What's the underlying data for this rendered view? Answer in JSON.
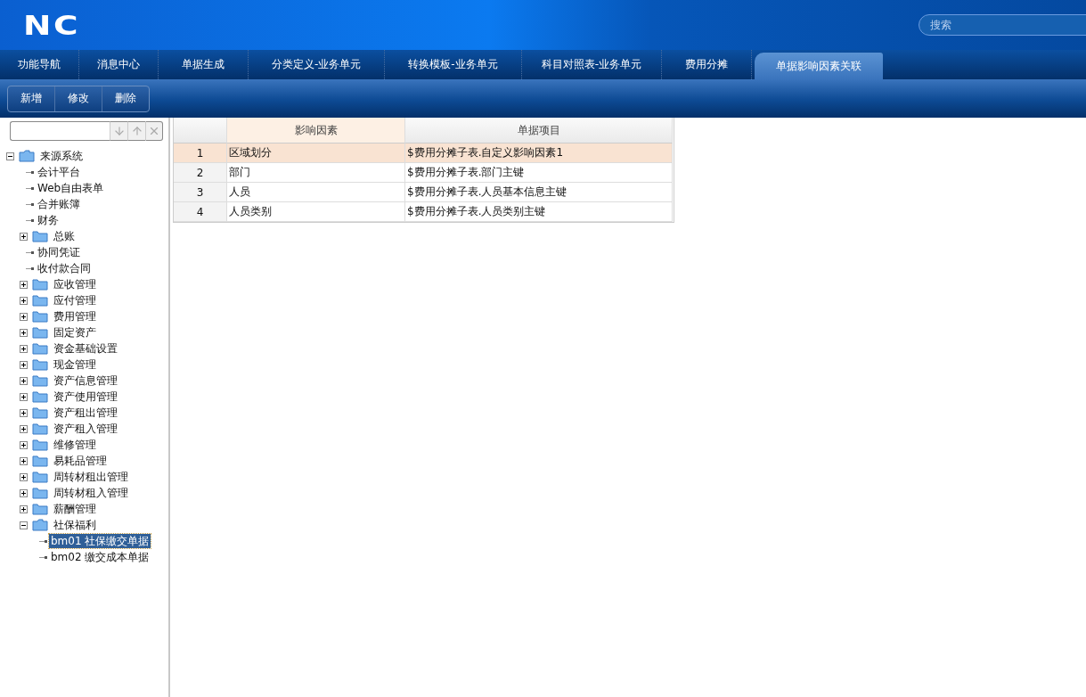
{
  "header": {
    "logo": "NC",
    "search": {
      "placeholder": "搜索"
    }
  },
  "tabs": [
    {
      "label": "功能导航",
      "selected": false
    },
    {
      "label": "消息中心",
      "selected": false
    },
    {
      "label": "单据生成",
      "selected": false
    },
    {
      "label": "分类定义-业务单元",
      "selected": false
    },
    {
      "label": "转换模板-业务单元",
      "selected": false
    },
    {
      "label": "科目对照表-业务单元",
      "selected": false
    },
    {
      "label": "费用分摊",
      "selected": false
    },
    {
      "label": "单据影响因素关联",
      "selected": true
    }
  ],
  "toolbar": {
    "buttons": [
      "新增",
      "修改",
      "删除"
    ]
  },
  "tree": {
    "items": [
      {
        "label": "来源系统",
        "kind": "folder",
        "expanded": true,
        "selected": false,
        "children": [
          {
            "label": "会计平台",
            "kind": "leaf",
            "selected": false
          },
          {
            "label": "Web自由表单",
            "kind": "leaf",
            "selected": false
          },
          {
            "label": "合并账簿",
            "kind": "leaf",
            "selected": false
          },
          {
            "label": "财务",
            "kind": "leaf",
            "selected": false
          },
          {
            "label": "总账",
            "kind": "folder",
            "expanded": false,
            "selected": false
          },
          {
            "label": "协同凭证",
            "kind": "leaf",
            "selected": false
          },
          {
            "label": "收付款合同",
            "kind": "leaf",
            "selected": false
          },
          {
            "label": "应收管理",
            "kind": "folder",
            "expanded": false,
            "selected": false
          },
          {
            "label": "应付管理",
            "kind": "folder",
            "expanded": false,
            "selected": false
          },
          {
            "label": "费用管理",
            "kind": "folder",
            "expanded": false,
            "selected": false
          },
          {
            "label": "固定资产",
            "kind": "folder",
            "expanded": false,
            "selected": false
          },
          {
            "label": "资金基础设置",
            "kind": "folder",
            "expanded": false,
            "selected": false
          },
          {
            "label": "现金管理",
            "kind": "folder",
            "expanded": false,
            "selected": false
          },
          {
            "label": "资产信息管理",
            "kind": "folder",
            "expanded": false,
            "selected": false
          },
          {
            "label": "资产使用管理",
            "kind": "folder",
            "expanded": false,
            "selected": false
          },
          {
            "label": "资产租出管理",
            "kind": "folder",
            "expanded": false,
            "selected": false
          },
          {
            "label": "资产租入管理",
            "kind": "folder",
            "expanded": false,
            "selected": false
          },
          {
            "label": "维修管理",
            "kind": "folder",
            "expanded": false,
            "selected": false
          },
          {
            "label": "易耗品管理",
            "kind": "folder",
            "expanded": false,
            "selected": false
          },
          {
            "label": "周转材租出管理",
            "kind": "folder",
            "expanded": false,
            "selected": false
          },
          {
            "label": "周转材租入管理",
            "kind": "folder",
            "expanded": false,
            "selected": false
          },
          {
            "label": "薪酬管理",
            "kind": "folder",
            "expanded": false,
            "selected": false
          },
          {
            "label": "社保福利",
            "kind": "folder",
            "expanded": true,
            "selected": false,
            "children": [
              {
                "label": "bm01 社保缴交单据",
                "kind": "leaf",
                "selected": true
              },
              {
                "label": "bm02 缴交成本单据",
                "kind": "leaf",
                "selected": false
              }
            ]
          }
        ]
      }
    ]
  },
  "table": {
    "columns": [
      {
        "label": "影响因素",
        "selected": true
      },
      {
        "label": "单据项目",
        "selected": false
      }
    ],
    "rows": [
      {
        "number": "1",
        "cells": [
          "区域划分",
          "$费用分摊子表.自定义影响因素1"
        ],
        "selected": true
      },
      {
        "number": "2",
        "cells": [
          "部门",
          "$费用分摊子表.部门主键"
        ],
        "selected": false
      },
      {
        "number": "3",
        "cells": [
          "人员",
          "$费用分摊子表.人员基本信息主键"
        ],
        "selected": false
      },
      {
        "number": "4",
        "cells": [
          "人员类别",
          "$费用分摊子表.人员类别主键"
        ],
        "selected": false
      }
    ]
  }
}
